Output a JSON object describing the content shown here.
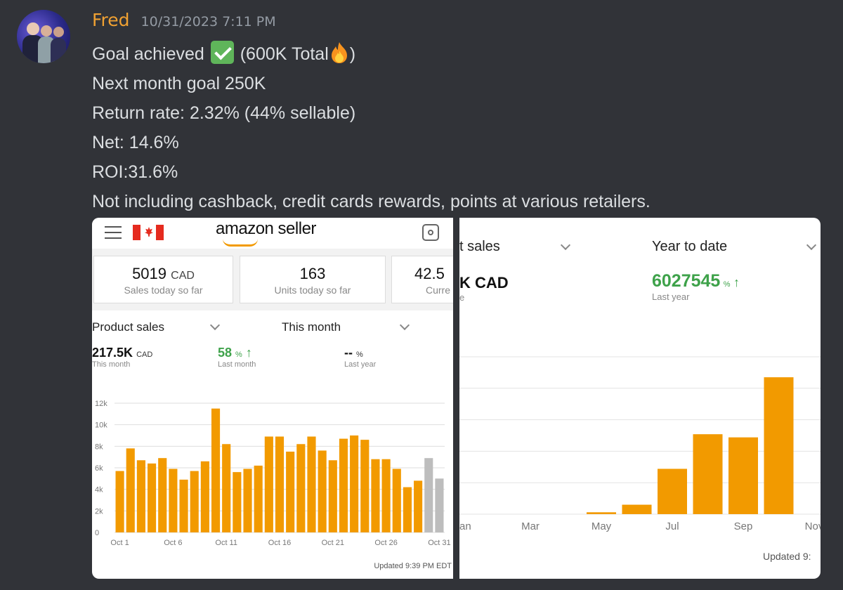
{
  "message": {
    "author": "Fred",
    "timestamp": "10/31/2023 7:11 PM",
    "lines": [
      "Goal achieved",
      "(600K Total",
      ")",
      "Next month goal 250K",
      "Return rate: 2.32% (44% sellable)",
      "Net: 14.6%",
      "ROI:31.6%",
      "Not including cashback, credit cards rewards, points at various retailers."
    ],
    "emoji": [
      "check-mark",
      "fire"
    ]
  },
  "screenshot_left": {
    "brand": "amazon seller",
    "kpis": [
      {
        "value": "5019",
        "unit": "CAD",
        "label": "Sales today so far"
      },
      {
        "value": "163",
        "unit": "",
        "label": "Units today so far"
      },
      {
        "value": "42.5",
        "unit": "",
        "label": "Curre"
      }
    ],
    "dropdown_metric": "Product sales",
    "dropdown_period": "This month",
    "metrics": [
      {
        "value": "217.5K",
        "unit": "CAD",
        "label": "This month"
      },
      {
        "value": "58",
        "unit": "%",
        "label": "Last month",
        "trend": "up"
      },
      {
        "value": "--",
        "unit": "%",
        "label": "Last year"
      }
    ],
    "updated": "Updated 9:39 PM EDT"
  },
  "screenshot_right": {
    "dropdown_metric": "t sales",
    "dropdown_period": "Year to date",
    "kpi_value": "6027545",
    "kpi_unit": "%",
    "kpi_label": "Last year",
    "left_unit": "K CAD",
    "left_label": "e",
    "updated": "Updated 9:"
  },
  "chart_data": [
    {
      "type": "bar",
      "title": "",
      "xlabel": "",
      "ylabel": "",
      "ylim": [
        0,
        12000
      ],
      "yticks": [
        "0",
        "2k",
        "4k",
        "6k",
        "8k",
        "10k",
        "12k"
      ],
      "x_tick_labels": [
        "Oct 1",
        "Oct 6",
        "Oct 11",
        "Oct 16",
        "Oct 21",
        "Oct 26",
        "Oct 31"
      ],
      "categories": [
        "Oct 1",
        "Oct 2",
        "Oct 3",
        "Oct 4",
        "Oct 5",
        "Oct 6",
        "Oct 7",
        "Oct 8",
        "Oct 9",
        "Oct 10",
        "Oct 11",
        "Oct 12",
        "Oct 13",
        "Oct 14",
        "Oct 15",
        "Oct 16",
        "Oct 17",
        "Oct 18",
        "Oct 19",
        "Oct 20",
        "Oct 21",
        "Oct 22",
        "Oct 23",
        "Oct 24",
        "Oct 25",
        "Oct 26",
        "Oct 27",
        "Oct 28",
        "Oct 29",
        "Oct 30",
        "Oct 31"
      ],
      "values": [
        5700,
        7800,
        6700,
        6400,
        6900,
        5900,
        4900,
        5700,
        6600,
        11500,
        8200,
        5600,
        5900,
        6200,
        8900,
        8900,
        7500,
        8200,
        8900,
        7600,
        6700,
        8700,
        9000,
        8600,
        6800,
        6800,
        5900,
        4200,
        4800,
        6900,
        5000
      ],
      "colors": {
        "bar": "#f29a00",
        "pending": "#bdbdbd"
      },
      "pending_categories": [
        "Oct 30",
        "Oct 31"
      ],
      "grid": true
    },
    {
      "type": "bar",
      "title": "",
      "xlabel": "",
      "ylabel": "",
      "x_tick_labels": [
        "an",
        "Mar",
        "May",
        "Jul",
        "Sep",
        "Nov"
      ],
      "categories": [
        "Jan",
        "Feb",
        "Mar",
        "Apr",
        "May",
        "Jun",
        "Jul",
        "Aug",
        "Sep",
        "Oct"
      ],
      "values": [
        0,
        0,
        0,
        0,
        3000,
        15000,
        72000,
        127000,
        122000,
        217500
      ],
      "colors": {
        "bar": "#f29a00"
      },
      "grid": true
    }
  ]
}
